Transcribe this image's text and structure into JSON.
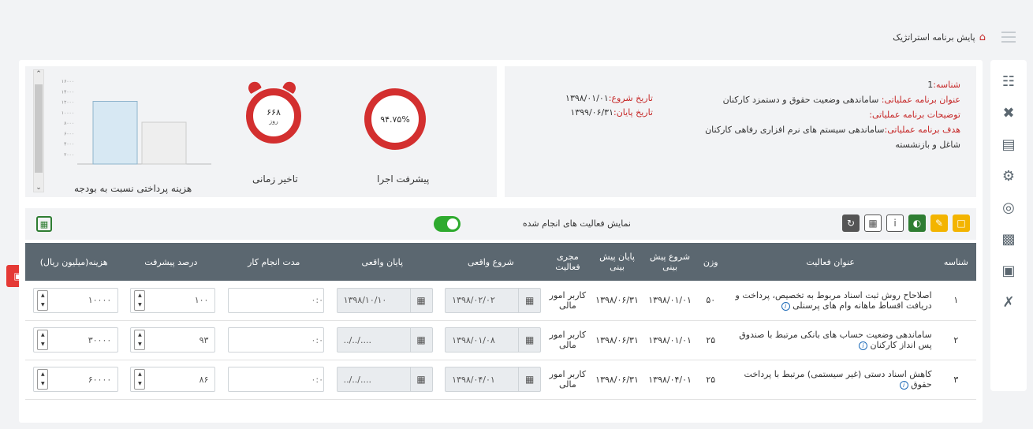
{
  "breadcrumb": {
    "label": "پایش برنامه استراتژیک"
  },
  "info": {
    "code_label": "شناسه:",
    "code_value": "1",
    "program_label": "عنوان برنامه عملیاتی:",
    "program_value": "ساماندهی وضعیت حقوق و دستمزد کارکنان",
    "desc_label": "توضیحات برنامه عملیاتی:",
    "desc_value": "",
    "goal_label": "هدف برنامه عملیاتی:",
    "goal_value": "ساماندهی سیستم های نرم افزاری رفاهی کارکنان شاغل و بازنشسته",
    "start_label": "تاریخ شروع:",
    "start_value": "۱۳۹۸/۰۱/۰۱",
    "end_label": "تاریخ پایان:",
    "end_value": "۱۳۹۹/۰۶/۳۱"
  },
  "kpi": {
    "progress_title": "پیشرفت اجرا",
    "progress_value": "۹۴.۷۵%",
    "delay_title": "تاخیر زمانی",
    "delay_value": "۶۶۸",
    "delay_unit": "روز",
    "cost_title": "هزینه پرداختی نسبت به بودجه"
  },
  "chart_data": {
    "type": "bar",
    "categories": [
      "",
      ""
    ],
    "values": [
      12000,
      8000
    ],
    "ylim": [
      0,
      16000
    ],
    "yticks": [
      "۲۰۰۰",
      "۴۰۰۰",
      "۶۰۰۰",
      "۸۰۰۰",
      "۱۰۰۰۰",
      "۱۲۰۰۰",
      "۱۴۰۰۰",
      "۱۶۰۰۰"
    ],
    "colors": [
      "#d7e8f3",
      "#eeeeee"
    ]
  },
  "toolbar": {
    "show_done_label": "نمایش فعالیت های انجام شده",
    "toggle_on": true
  },
  "table": {
    "headers": [
      "شناسه",
      "عنوان فعالیت",
      "وزن",
      "شروع پیش بینی",
      "پایان پیش بینی",
      "مجری فعالیت",
      "شروع واقعی",
      "پایان واقعی",
      "مدت انجام کار",
      "درصد پیشرفت",
      "هزینه(میلیون ریال)"
    ],
    "rows": [
      {
        "id": "۱",
        "title": "اصلاحاح روش ثبت اسناد مربوط به تخصیص، پرداخت و دریافت اقساط ماهانه وام های پرسنلی",
        "weight": "۵۰",
        "plan_start": "۱۳۹۸/۰۱/۰۱",
        "plan_end": "۱۳۹۸/۰۶/۳۱",
        "owner": "کاربر امور مالی",
        "actual_start": "۱۳۹۸/۰۲/۰۲",
        "actual_end": "۱۳۹۸/۱۰/۱۰",
        "duration": "۰:۰",
        "progress": "۱۰۰",
        "cost": "۱۰۰۰۰"
      },
      {
        "id": "۲",
        "title": "ساماندهی وضعیت حساب های بانکی مرتبط با صندوق پس انداز کارکنان",
        "weight": "۲۵",
        "plan_start": "۱۳۹۸/۰۱/۰۱",
        "plan_end": "۱۳۹۸/۰۶/۳۱",
        "owner": "کاربر امور مالی",
        "actual_start": "۱۳۹۸/۰۱/۰۸",
        "actual_end": "..../../..",
        "duration": "۰:۰",
        "progress": "۹۳",
        "cost": "۳۰۰۰۰"
      },
      {
        "id": "۳",
        "title": "کاهش اسناد دستی (غیر سیستمی) مرتبط با پرداخت حقوق",
        "weight": "۲۵",
        "plan_start": "۱۳۹۸/۰۴/۰۱",
        "plan_end": "۱۳۹۸/۰۶/۳۱",
        "owner": "کاربر امور مالی",
        "actual_start": "۱۳۹۸/۰۴/۰۱",
        "actual_end": "..../../..",
        "duration": "۰:۰",
        "progress": "۸۶",
        "cost": "۶۰۰۰۰"
      }
    ]
  }
}
